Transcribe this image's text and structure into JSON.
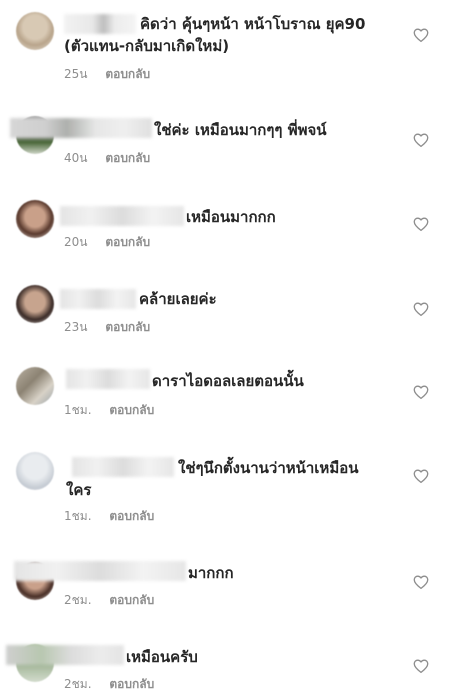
{
  "comments": [
    {
      "text": "คิดว่า คุ้นๆหน้า หน้าโบราณ ยุค90",
      "text2": "(ตัวแทน-กลับมาเกิดใหม่)",
      "time": "25น",
      "reply": "ตอบกลับ"
    },
    {
      "text": "ใช่ค่ะ เหมือนมากๆๆ พี่พจน์",
      "time": "40น",
      "reply": "ตอบกลับ"
    },
    {
      "text": "เหมือนมากกก",
      "time": "20น",
      "reply": "ตอบกลับ"
    },
    {
      "text": "คล้ายเลยค่ะ",
      "time": "23น",
      "reply": "ตอบกลับ"
    },
    {
      "text": "ดาราไอดอลเลยตอนนั้น",
      "time": "1ชม.",
      "reply": "ตอบกลับ"
    },
    {
      "text": "ใช่ๆนึกตั้งนานว่าหน้าเหมือน",
      "text2": "ใคร",
      "time": "1ชม.",
      "reply": "ตอบกลับ"
    },
    {
      "text": "มากกก",
      "time": "2ชม.",
      "reply": "ตอบกลับ"
    },
    {
      "text": "เหมือนครับ",
      "time": "2ชม.",
      "reply": "ตอบกลับ"
    }
  ],
  "icons": {
    "like": "heart-outline-icon"
  },
  "colors": {
    "text": "#262626",
    "meta": "#8e8e8e",
    "icon": "#8e8e8e"
  }
}
